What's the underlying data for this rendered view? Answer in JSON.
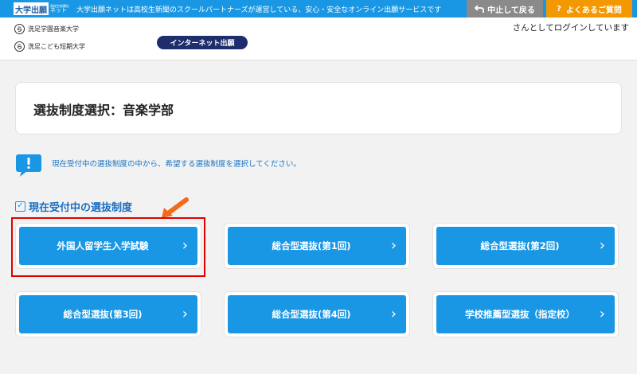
{
  "topbar": {
    "logo_main": "大学出願",
    "logo_sub_small": "高校生新聞社",
    "logo_sub": "ネット",
    "tagline": "大学出願ネットは高校生新聞のスクールパートナーズが運営している、安心・安全なオンライン出願サービスです",
    "back_label": "中止して戻る",
    "back_icon": "return-arrow-icon",
    "faq_label": "よくあるご質問",
    "faq_icon_text": "?"
  },
  "header": {
    "schools": [
      {
        "emblem": "ら",
        "name": "洗足学園音楽大学"
      },
      {
        "emblem": "ら",
        "name": "洗足こども短期大学"
      }
    ],
    "badge": "インターネット出願",
    "login_text": "さんとしてログインしています"
  },
  "main": {
    "title": "選抜制度選択：音楽学部",
    "info_text": "現在受付中の選抜制度の中から、希望する選抜制度を選択してください。",
    "section_title": "現在受付中の選抜制度",
    "options": [
      {
        "label": "外国人留学生入学試験"
      },
      {
        "label": "総合型選抜(第1回)"
      },
      {
        "label": "総合型選抜(第2回)"
      },
      {
        "label": "総合型選抜(第3回)"
      },
      {
        "label": "総合型選抜(第4回)"
      },
      {
        "label": "学校推薦型選抜（指定校）"
      }
    ]
  },
  "colors": {
    "brand_blue": "#1a97e4",
    "faq_orange": "#f39800",
    "badge_navy": "#1e2d6b",
    "highlight_red": "#e00000",
    "arrow_orange": "#f26a1b"
  }
}
